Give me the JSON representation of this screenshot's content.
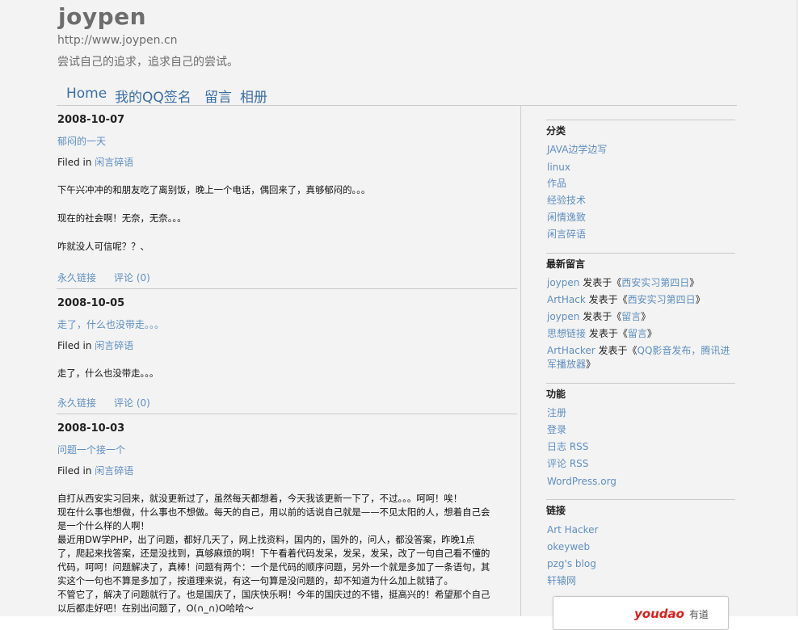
{
  "site": {
    "title": "joypen",
    "url": "http://www.joypen.cn",
    "tagline": "尝试自己的追求，追求自己的尝试。"
  },
  "nav": [
    {
      "label": "Home"
    },
    {
      "label": "我的QQ签名"
    },
    {
      "label": "留言"
    },
    {
      "label": "相册"
    }
  ],
  "posts": [
    {
      "date": "2008-10-07",
      "title": "郁闷的一天",
      "filed_prefix": "Filed in",
      "category": "闲言碎语",
      "body": [
        "下午兴冲冲的和朋友吃了离别饭，晚上一个电话，偶回来了，真够郁闷的。。。",
        "现在的社会啊！无奈，无奈。。。",
        "咋就没人可信呢？？、"
      ],
      "permalink": "永久链接",
      "comments": "评论 (0)"
    },
    {
      "date": "2008-10-05",
      "title": "走了，什么也没带走。。。",
      "filed_prefix": "Filed in",
      "category": "闲言碎语",
      "body": [
        "走了，什么也没带走。。。"
      ],
      "permalink": "永久链接",
      "comments": "评论 (0)"
    },
    {
      "date": "2008-10-03",
      "title": "问题一个接一个",
      "filed_prefix": "Filed in",
      "category": "闲言碎语",
      "body": [
        "自打从西安实习回来，就没更新过了，虽然每天都想着，今天我该更新一下了，不过。。。呵呵！唉！",
        "现在什么事也想做，什么事也不想做。每天的自己，用以前的话说自己就是——不见太阳的人，想着自己会",
        "是一个什么样的人啊！",
        "最近用DW学PHP，出了问题，都好几天了，网上找资料，国内的，国外的，问人，都没答案，昨晚1点",
        "了，爬起来找答案，还是没找到，真够麻烦的啊！下午看着代码发呆，发呆，发呆，改了一句自己看不懂的",
        "代码，呵呵！问题解决了，真棒！问题有两个：一个是代码的顺序问题，另外一个就是多加了一条语句，其",
        "实这个一句也不算是多加了，按道理来说，有这一句算是没问题的，却不知道为什么加上就错了。",
        "不管它了，解决了问题就行了。也是国庆了，国庆快乐啊！今年的国庆过的不错，挺高兴的！希望那个自己",
        "以后都走好吧！在别出问题了，O(∩_∩)O哈哈～"
      ]
    }
  ],
  "sidebar": {
    "categories_title": "分类",
    "categories": [
      "JAVA边学边写",
      "linux",
      "作品",
      "经验技术",
      "闲情逸致",
      "闲言碎语"
    ],
    "recent_comments_title": "最新留言",
    "recent_comments": [
      {
        "author": "joypen",
        "mid": "发表于《",
        "post": "西安实习第四日",
        "end": "》"
      },
      {
        "author": "ArtHack",
        "mid": "发表于《",
        "post": "西安实习第四日",
        "end": "》"
      },
      {
        "author": "joypen",
        "mid": "发表于《",
        "post": "留言",
        "end": "》"
      },
      {
        "author": "思想链接",
        "mid": "发表于《",
        "post": "留言",
        "end": "》"
      },
      {
        "author": "ArtHacker",
        "mid": "发表于《",
        "post": "QQ影音发布，腾讯进",
        "post2": "军播放器",
        "end": "》"
      }
    ],
    "functions_title": "功能",
    "functions": [
      "注册",
      "登录",
      "日志 RSS",
      "评论 RSS",
      "WordPress.org"
    ],
    "links_title": "链接",
    "links": [
      "Art Hacker",
      "okeyweb",
      "pzg's blog",
      "轩辕网"
    ]
  },
  "widget": {
    "logo": "youdao",
    "logo_cn": "有道"
  }
}
